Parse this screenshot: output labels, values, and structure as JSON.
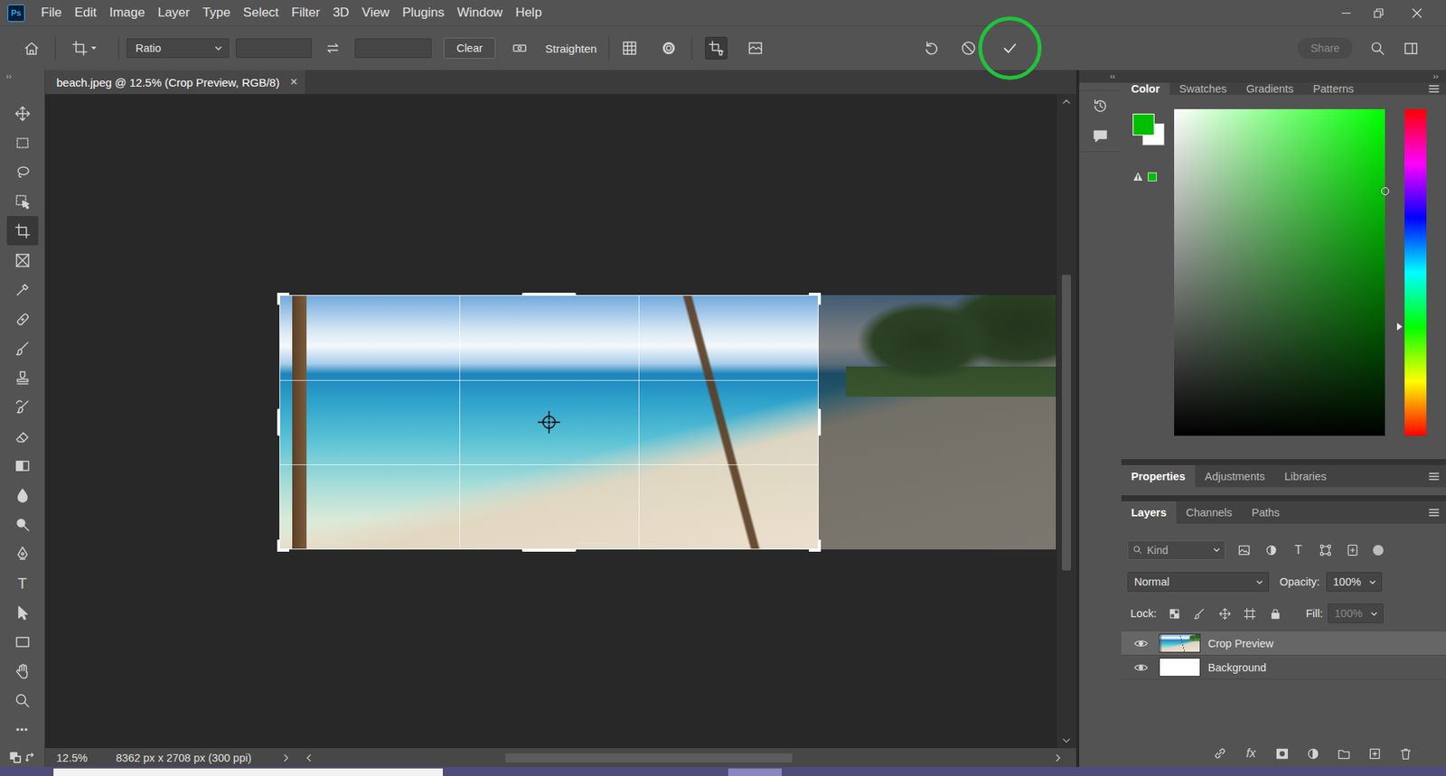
{
  "app": {
    "logo": "Ps",
    "menu": [
      "File",
      "Edit",
      "Image",
      "Layer",
      "Type",
      "Select",
      "Filter",
      "3D",
      "View",
      "Plugins",
      "Window",
      "Help"
    ]
  },
  "options_bar": {
    "aspect": "Ratio",
    "clear": "Clear",
    "straighten": "Straighten",
    "delete_cropped_pixels": {
      "on": true
    },
    "content_aware": {
      "on": false
    },
    "commit": {
      "annotated": true
    },
    "share": {
      "label": "Share",
      "disabled": true
    }
  },
  "toolbar": {
    "collapse": "››",
    "tools": [
      {
        "kind": "move",
        "selected": false
      },
      {
        "kind": "marquee",
        "selected": false
      },
      {
        "kind": "lasso",
        "selected": false
      },
      {
        "kind": "object-selection",
        "selected": false
      },
      {
        "kind": "crop",
        "selected": true
      },
      {
        "kind": "frame",
        "selected": false
      },
      {
        "kind": "eyedropper",
        "selected": false
      },
      {
        "kind": "healing",
        "selected": false
      },
      {
        "kind": "brush",
        "selected": false
      },
      {
        "kind": "stamp",
        "selected": false
      },
      {
        "kind": "history-brush",
        "selected": false
      },
      {
        "kind": "eraser",
        "selected": false
      },
      {
        "kind": "gradient",
        "selected": false
      },
      {
        "kind": "blur",
        "selected": false
      },
      {
        "kind": "dodge",
        "selected": false
      },
      {
        "kind": "pen",
        "selected": false
      },
      {
        "kind": "type",
        "glyph": "T",
        "selected": false
      },
      {
        "kind": "path-selection",
        "selected": false
      },
      {
        "kind": "rectangle",
        "selected": false
      },
      {
        "kind": "hand",
        "selected": false
      },
      {
        "kind": "zoom",
        "selected": false
      },
      {
        "kind": "more",
        "glyph": "•••",
        "selected": false
      }
    ]
  },
  "document": {
    "tab": {
      "title": "beach.jpeg @ 12.5% (Crop Preview, RGB/8)",
      "close": "×"
    }
  },
  "scrollbars": {
    "vertical": {
      "start": 0.265,
      "size": 0.475
    },
    "horizontal": {
      "start": 0.259,
      "size": 0.388
    }
  },
  "status_bar": {
    "zoom": "12.5%",
    "info": "8362 px x 2708 px (300 ppi)"
  },
  "dock": {
    "collapse": "‹‹"
  },
  "panels": {
    "collapse": "››",
    "color": {
      "tabs": [
        {
          "label": "Color",
          "selected": true
        },
        {
          "label": "Swatches",
          "selected": false
        },
        {
          "label": "Gradients",
          "selected": false
        },
        {
          "label": "Patterns",
          "selected": false
        }
      ],
      "foreground": "#00bf00",
      "background": "#ffffff",
      "hue_level": 0.667,
      "picker": {
        "saturation": 1,
        "brightness": 0.75
      }
    },
    "properties": {
      "tabs": [
        {
          "label": "Properties",
          "selected": true
        },
        {
          "label": "Adjustments",
          "selected": false
        },
        {
          "label": "Libraries",
          "selected": false
        }
      ]
    },
    "layers": {
      "tabs": [
        {
          "label": "Layers",
          "selected": true
        },
        {
          "label": "Channels",
          "selected": false
        },
        {
          "label": "Paths",
          "selected": false
        }
      ],
      "filter_kind": "Kind",
      "type_filter": "T",
      "filter_on": false,
      "blend_mode": "Normal",
      "opacity_label": "Opacity:",
      "opacity": "100%",
      "lock_label": "Lock:",
      "fill_label": "Fill:",
      "fill": {
        "value": "100%",
        "disabled": true
      },
      "layers": [
        {
          "name": "Crop Preview",
          "kind": "photo",
          "visible": true,
          "selected": true
        },
        {
          "name": "Background",
          "kind": "white",
          "visible": true,
          "selected": false
        }
      ],
      "fx": "fx"
    }
  }
}
